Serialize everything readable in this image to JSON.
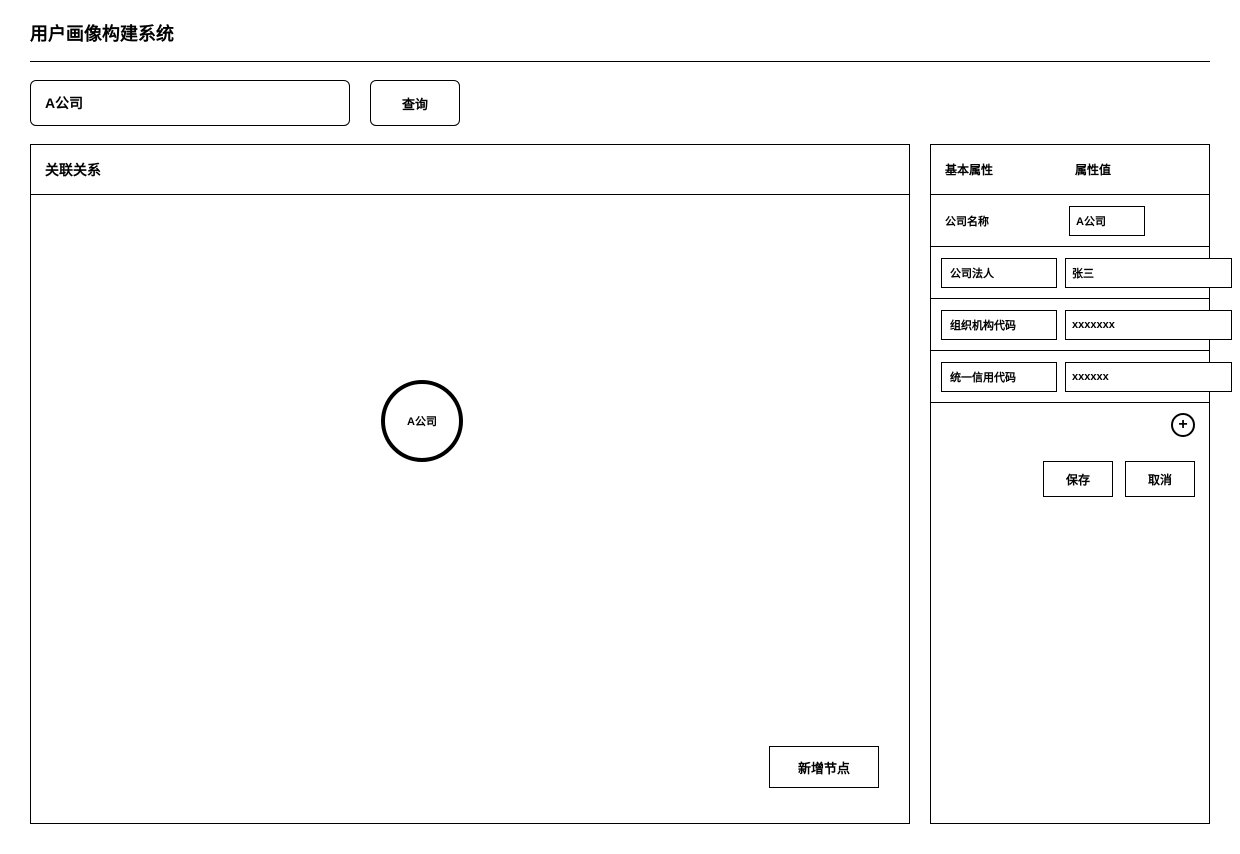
{
  "page": {
    "title": "用户画像构建系统"
  },
  "search": {
    "value": "A公司",
    "query_label": "查询"
  },
  "graph": {
    "header": "关联关系",
    "node_label": "A公司",
    "add_node_label": "新增节点"
  },
  "sidebar": {
    "header_attr": "基本属性",
    "header_value": "属性值",
    "rows": [
      {
        "label": "公司名称",
        "value": "A公司",
        "editable_label": false,
        "deletable": false
      },
      {
        "label": "公司法人",
        "value": "张三",
        "editable_label": true,
        "deletable": true
      },
      {
        "label": "组织机构代码",
        "value": "xxxxxxx",
        "editable_label": true,
        "deletable": true
      },
      {
        "label": "统一信用代码",
        "value": "xxxxxx",
        "editable_label": true,
        "deletable": true
      }
    ],
    "save_label": "保存",
    "cancel_label": "取消"
  }
}
